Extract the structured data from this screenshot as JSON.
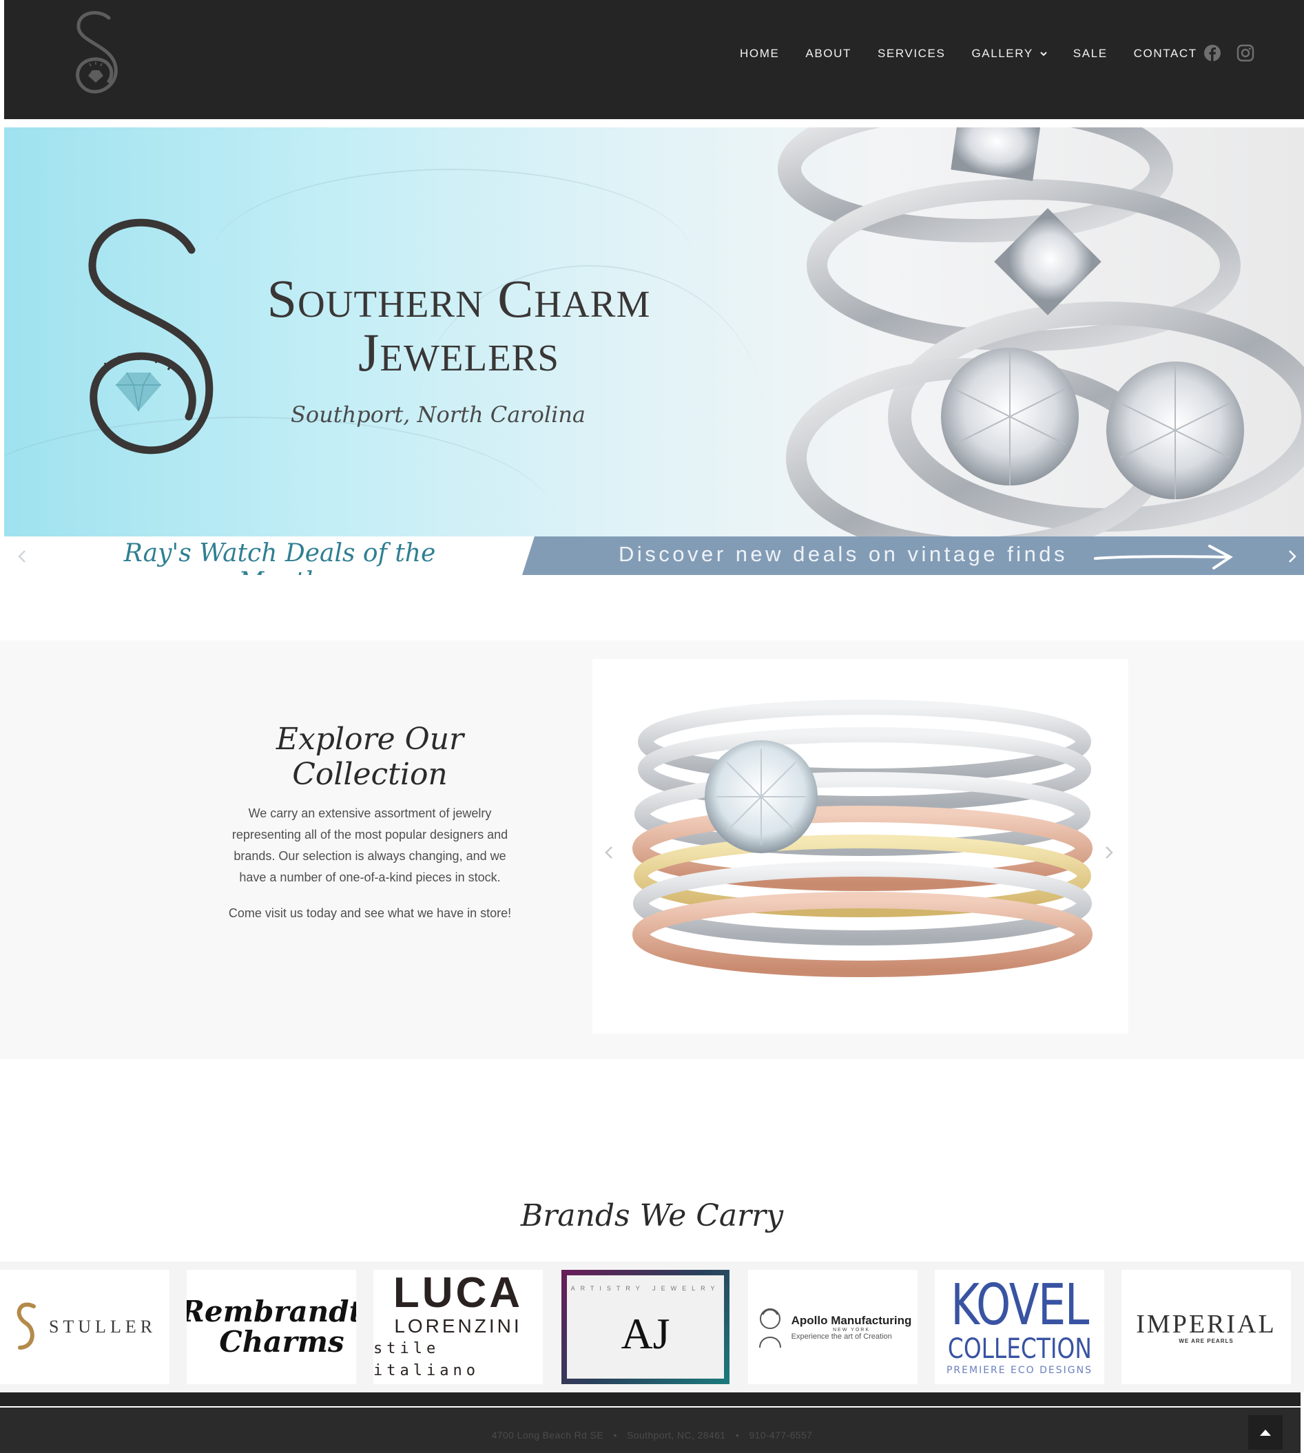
{
  "nav": {
    "items": [
      {
        "label": "HOME"
      },
      {
        "label": "ABOUT"
      },
      {
        "label": "SERVICES"
      },
      {
        "label": "GALLERY"
      },
      {
        "label": "SALE"
      },
      {
        "label": "CONTACT"
      }
    ],
    "social": [
      "facebook-icon",
      "instagram-icon"
    ]
  },
  "hero": {
    "title_line1": "Southern Charm",
    "title_line2": "Jewelers",
    "subtitle": "Southport, North Carolina",
    "promo_left": "Ray's Watch Deals of the Month",
    "promo_right": "Discover new deals on vintage finds"
  },
  "collection": {
    "title": "Explore Our Collection",
    "body": "We carry an extensive assortment of jewelry representing all of the most popular designers and brands. Our selection is always changing, and we have a number of one-of-a-kind pieces in stock.",
    "cta": "Come visit us today and see what we have in store!"
  },
  "brands": {
    "title": "Brands We Carry",
    "stuller": "STULLER",
    "rembrandt_1": "Rembrandt",
    "rembrandt_2": "Charms",
    "luca_1": "LUCA",
    "luca_2": "LORENZINI",
    "luca_3": "stile italiano",
    "aj_mark": "AJ",
    "aj_ring": "ARTISTRY JEWELRY",
    "apollo_1": "Apollo Manufacturing",
    "apollo_2": "NEW YORK",
    "apollo_3": "Experience the art of Creation",
    "kovel_1": "KOVEL",
    "kovel_2": "COLLECTION",
    "kovel_3": "PREMIERE ECO DESIGNS",
    "imperial_1": "IMPERIAL",
    "imperial_2": "WE ARE PEARLS"
  },
  "footer": {
    "address": "4700 Long Beach Rd SE",
    "city": "Southport, NC, 28461",
    "phone": "910-477-6557"
  },
  "colors": {
    "header_bg": "#252525",
    "promo_teal": "#2f7f91",
    "promo_band": "#839cb6",
    "section_bg": "#f8f8f8"
  }
}
